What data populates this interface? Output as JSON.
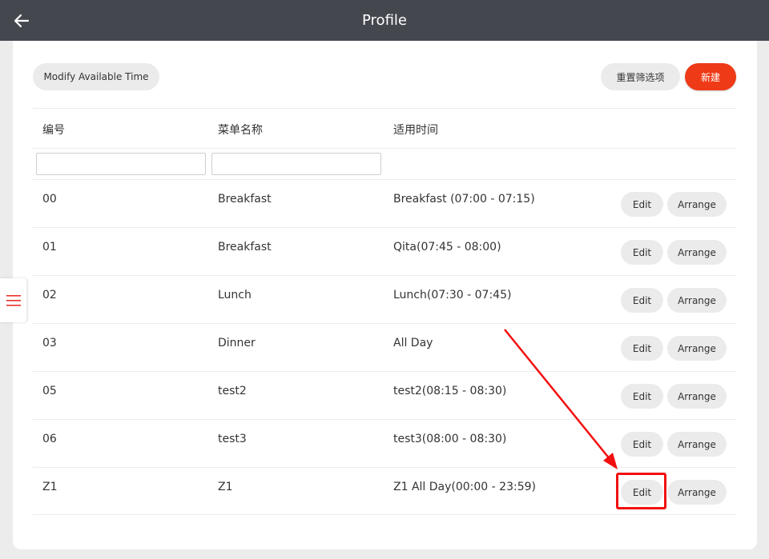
{
  "header": {
    "title": "Profile",
    "back_icon": "arrow-left-icon"
  },
  "toolbar": {
    "modify_label": "Modify Available Time",
    "reset_label": "重置筛选项",
    "new_label": "新建",
    "new_color": "#ee3a16"
  },
  "table": {
    "columns": [
      "编号",
      "菜单名称",
      "适用时间"
    ],
    "filters": [
      {
        "value": "",
        "placeholder": ""
      },
      {
        "value": "",
        "placeholder": ""
      }
    ],
    "rows": [
      {
        "id": "00",
        "name": "Breakfast",
        "time": "Breakfast (07:00 - 07:15)",
        "edit": "Edit",
        "arrange": "Arrange"
      },
      {
        "id": "01",
        "name": "Breakfast",
        "time": "Qita(07:45 - 08:00)",
        "edit": "Edit",
        "arrange": "Arrange"
      },
      {
        "id": "02",
        "name": "Lunch",
        "time": "Lunch(07:30 - 07:45)",
        "edit": "Edit",
        "arrange": "Arrange"
      },
      {
        "id": "03",
        "name": "Dinner",
        "time": "All Day",
        "edit": "Edit",
        "arrange": "Arrange"
      },
      {
        "id": "05",
        "name": "test2",
        "time": "test2(08:15 - 08:30)",
        "edit": "Edit",
        "arrange": "Arrange"
      },
      {
        "id": "06",
        "name": "test3",
        "time": "test3(08:00 - 08:30)",
        "edit": "Edit",
        "arrange": "Arrange"
      },
      {
        "id": "Z1",
        "name": "Z1",
        "time": "Z1 All Day(00:00 - 23:59)",
        "edit": "Edit",
        "arrange": "Arrange"
      }
    ]
  },
  "sidebar_toggle": {
    "icon": "hamburger-menu-icon",
    "color": "#e8332a"
  },
  "annotation": {
    "color": "#f20f0f"
  }
}
